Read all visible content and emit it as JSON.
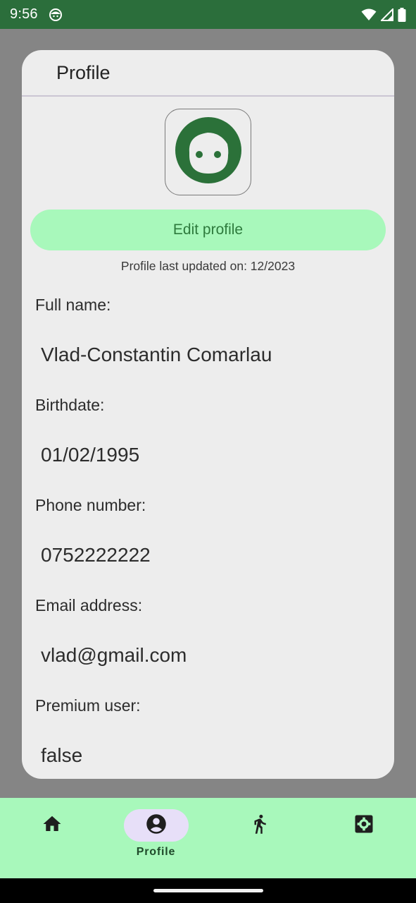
{
  "status_bar": {
    "time": "9:56",
    "app_icon": "android-face-icon",
    "right_icons": [
      "wifi-icon",
      "cell-signal-icon",
      "battery-icon"
    ]
  },
  "card": {
    "title": "Profile",
    "avatar_icon": "face-icon",
    "edit_button_label": "Edit profile",
    "updated_text": "Profile last updated on: 12/2023",
    "fields": [
      {
        "label": "Full name:",
        "value": "Vlad-Constantin Comarlau"
      },
      {
        "label": "Birthdate:",
        "value": "01/02/1995"
      },
      {
        "label": "Phone number:",
        "value": "0752222222"
      },
      {
        "label": "Email address:",
        "value": "vlad@gmail.com"
      },
      {
        "label": "Premium user:",
        "value": "false"
      }
    ]
  },
  "bottom_nav": {
    "items": [
      {
        "icon": "home-icon",
        "label": "",
        "active": false
      },
      {
        "icon": "account-circle-icon",
        "label": "Profile",
        "active": true
      },
      {
        "icon": "walk-icon",
        "label": "",
        "active": false
      },
      {
        "icon": "settings-icon",
        "label": "",
        "active": false
      }
    ]
  },
  "colors": {
    "status_bar": "#2b6e3b",
    "accent_green": "#a8f8bb",
    "avatar_green": "#2b7139",
    "active_pill": "#e7dff8",
    "card_background": "#ededed",
    "backdrop": "#858585"
  }
}
